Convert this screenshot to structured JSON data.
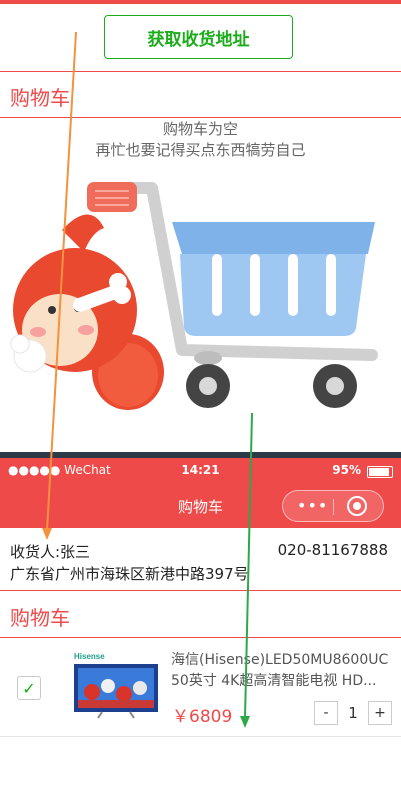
{
  "upper": {
    "address_button_label": "获取收货地址",
    "cart_title": "购物车",
    "empty_line1": "购物车为空",
    "empty_line2": "再忙也要记得买点东西犒劳自己"
  },
  "status_bar": {
    "carrier": "●●●●● WeChat",
    "time": "14:21",
    "battery": "95%"
  },
  "nav": {
    "title": "购物车",
    "more_icon": "more-dots-icon",
    "close_icon": "target-circle-icon"
  },
  "address": {
    "recipient": "收货人:张三",
    "phone": "020-81167888",
    "detail": "广东省广州市海珠区新港中路397号"
  },
  "cart_title": "购物车",
  "cart_items": [
    {
      "checked": true,
      "image_brand_text": "Hisense",
      "name": "海信(Hisense)LED50MU8600UC 50英寸 4K超高清智能电视 HD...",
      "price": "￥6809",
      "qty_minus": "-",
      "qty": "1",
      "qty_plus": "+"
    }
  ],
  "colors": {
    "accent_red": "#ef4a4a",
    "wechat_green": "#1aad19",
    "arrow_orange": "#f5923e",
    "arrow_green": "#2ea84a"
  }
}
